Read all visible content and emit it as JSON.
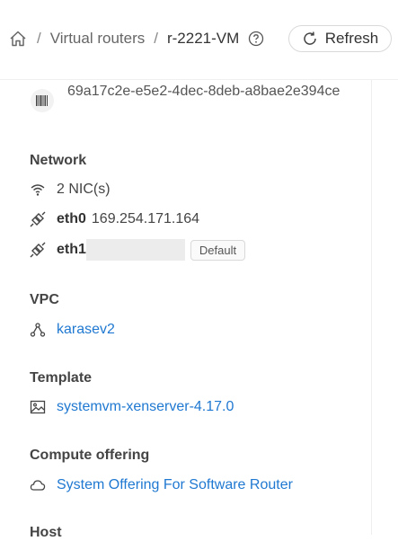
{
  "breadcrumb": {
    "items": [
      "Virtual routers",
      "r-2221-VM"
    ],
    "separator": "/"
  },
  "header": {
    "refresh_label": "Refresh"
  },
  "details": {
    "uuid": "69a17c2e-e5e2-4dec-8deb-a8bae2e394ce",
    "network": {
      "title": "Network",
      "nic_count": "2 NIC(s)",
      "nics": [
        {
          "name": "eth0",
          "ip": "169.254.171.164"
        },
        {
          "name": "eth1",
          "ip": "",
          "tag": "Default"
        }
      ]
    },
    "vpc": {
      "title": "VPC",
      "value": "karasev2"
    },
    "template": {
      "title": "Template",
      "value": "systemvm-xenserver-4.17.0"
    },
    "compute_offering": {
      "title": "Compute offering",
      "value": "System Offering For Software Router"
    },
    "host": {
      "title": "Host"
    }
  },
  "colors": {
    "link": "#1f78d1",
    "text": "#444444",
    "border": "#d9d9d9"
  }
}
